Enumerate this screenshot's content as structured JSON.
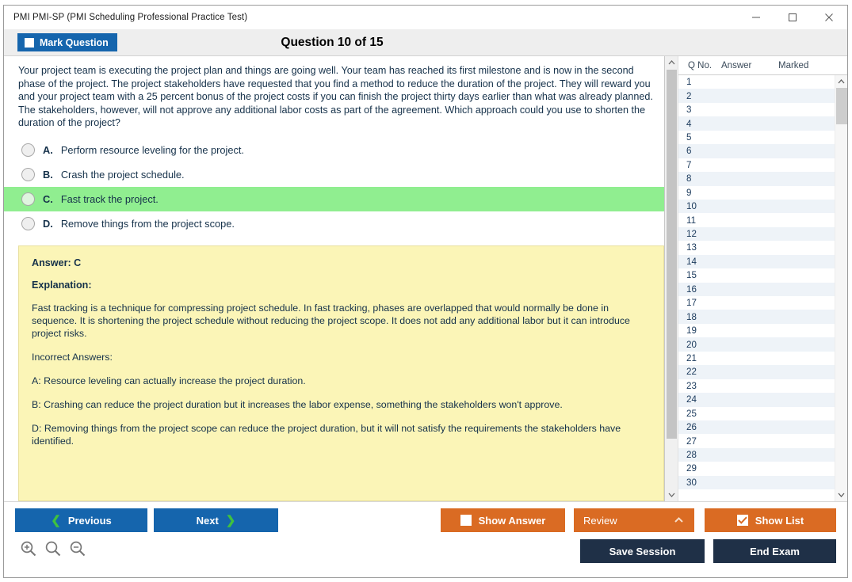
{
  "window": {
    "title": "PMI PMI-SP (PMI Scheduling Professional Practice Test)",
    "minimize_label": "–",
    "maximize_label": "□",
    "close_label": "×"
  },
  "header": {
    "mark_question_label": "Mark Question",
    "question_title": "Question 10 of 15",
    "marked": false
  },
  "question": {
    "text": "Your project team is executing the project plan and things are going well. Your team has reached its first milestone and is now in the second phase of the project. The project stakeholders have requested that you find a method to reduce the duration of the project. They will reward you and your project team with a 25 percent bonus of the project costs if you can finish the project thirty days earlier than what was already planned. The stakeholders, however, will not approve any additional labor costs as part of the agreement. Which approach could you use to shorten the duration of the project?",
    "options": [
      {
        "letter": "A.",
        "text": "Perform resource leveling for the project.",
        "selected": false
      },
      {
        "letter": "B.",
        "text": "Crash the project schedule.",
        "selected": false
      },
      {
        "letter": "C.",
        "text": "Fast track the project.",
        "selected": true
      },
      {
        "letter": "D.",
        "text": "Remove things from the project scope.",
        "selected": false
      }
    ]
  },
  "explanation": {
    "answer_label": "Answer: C",
    "explanation_label": "Explanation:",
    "paragraphs": [
      "Fast tracking is a technique for compressing project schedule. In fast tracking, phases are overlapped that would normally be done in sequence. It is shortening the project schedule without reducing the project scope. It does not add any additional labor but it can introduce project risks.",
      "Incorrect Answers:",
      "A: Resource leveling can actually increase the project duration.",
      "B: Crashing can reduce the project duration but it increases the labor expense, something the stakeholders won't approve.",
      "D: Removing things from the project scope can reduce the project duration, but it will not satisfy the requirements the stakeholders have identified."
    ]
  },
  "question_list": {
    "columns": [
      "Q No.",
      "Answer",
      "Marked"
    ],
    "rows": [
      {
        "no": "1",
        "answer": "",
        "marked": ""
      },
      {
        "no": "2",
        "answer": "",
        "marked": ""
      },
      {
        "no": "3",
        "answer": "",
        "marked": ""
      },
      {
        "no": "4",
        "answer": "",
        "marked": ""
      },
      {
        "no": "5",
        "answer": "",
        "marked": ""
      },
      {
        "no": "6",
        "answer": "",
        "marked": ""
      },
      {
        "no": "7",
        "answer": "",
        "marked": ""
      },
      {
        "no": "8",
        "answer": "",
        "marked": ""
      },
      {
        "no": "9",
        "answer": "",
        "marked": ""
      },
      {
        "no": "10",
        "answer": "",
        "marked": ""
      },
      {
        "no": "11",
        "answer": "",
        "marked": ""
      },
      {
        "no": "12",
        "answer": "",
        "marked": ""
      },
      {
        "no": "13",
        "answer": "",
        "marked": ""
      },
      {
        "no": "14",
        "answer": "",
        "marked": ""
      },
      {
        "no": "15",
        "answer": "",
        "marked": ""
      },
      {
        "no": "16",
        "answer": "",
        "marked": ""
      },
      {
        "no": "17",
        "answer": "",
        "marked": ""
      },
      {
        "no": "18",
        "answer": "",
        "marked": ""
      },
      {
        "no": "19",
        "answer": "",
        "marked": ""
      },
      {
        "no": "20",
        "answer": "",
        "marked": ""
      },
      {
        "no": "21",
        "answer": "",
        "marked": ""
      },
      {
        "no": "22",
        "answer": "",
        "marked": ""
      },
      {
        "no": "23",
        "answer": "",
        "marked": ""
      },
      {
        "no": "24",
        "answer": "",
        "marked": ""
      },
      {
        "no": "25",
        "answer": "",
        "marked": ""
      },
      {
        "no": "26",
        "answer": "",
        "marked": ""
      },
      {
        "no": "27",
        "answer": "",
        "marked": ""
      },
      {
        "no": "28",
        "answer": "",
        "marked": ""
      },
      {
        "no": "29",
        "answer": "",
        "marked": ""
      },
      {
        "no": "30",
        "answer": "",
        "marked": ""
      }
    ]
  },
  "footer": {
    "previous_label": "Previous",
    "next_label": "Next",
    "show_answer_label": "Show Answer",
    "show_answer_checked": false,
    "review_label": "Review",
    "show_list_label": "Show List",
    "show_list_checked": true,
    "save_session_label": "Save Session",
    "end_exam_label": "End Exam"
  },
  "colors": {
    "primary_blue": "#1565ad",
    "orange": "#da6b23",
    "navy": "#1f3047",
    "correct_green": "#90ee90",
    "explanation_yellow": "#fbf5b7",
    "chevron_green": "#3fc13f"
  }
}
